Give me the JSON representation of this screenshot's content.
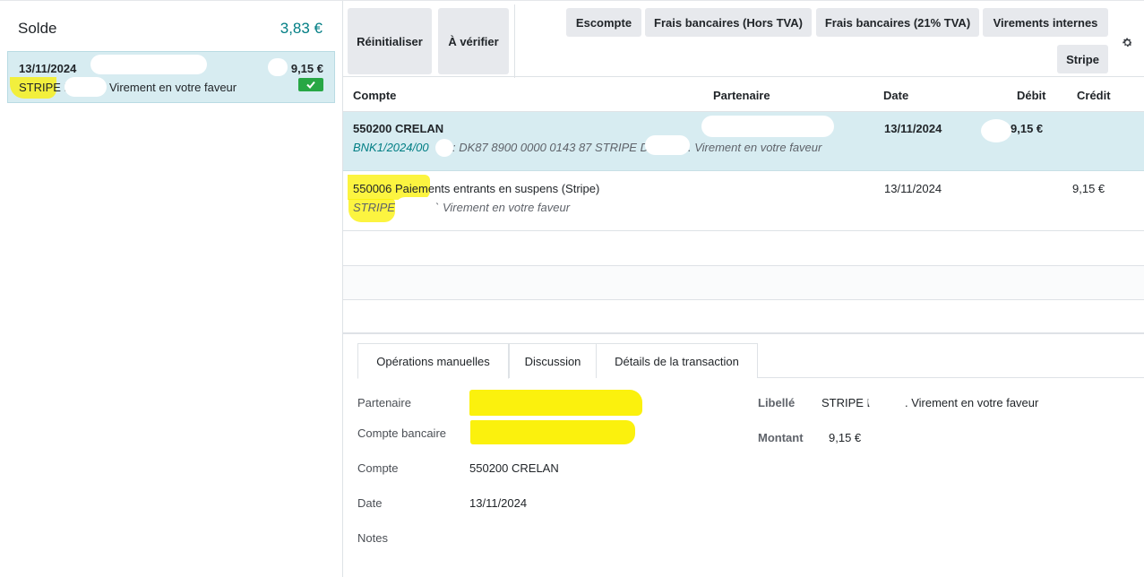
{
  "left": {
    "solde_label": "Solde",
    "solde_value": "3,83 €",
    "statement_line": {
      "date": "13/11/2024",
      "amount": "9,15 €",
      "label_prefix": "STRIPE D",
      "label_suffix": "Virement en votre faveur"
    }
  },
  "toolbar": {
    "reset": "Réinitialiser",
    "to_check": "À vérifier",
    "models": [
      "Escompte",
      "Frais bancaires (Hors TVA)",
      "Frais bancaires (21% TVA)",
      "Virements internes",
      "Stripe"
    ]
  },
  "grid": {
    "headers": {
      "account": "Compte",
      "partner": "Partenaire",
      "date": "Date",
      "debit": "Débit",
      "credit": "Crédit"
    },
    "rows": [
      {
        "account": "550200 CRELAN",
        "date": "13/11/2024",
        "debit": "9,15 €",
        "ref": "BNK1/2024/00",
        "memo": ": DK87 8900 0000 0143 87 STRIPE D",
        "memo_tail": ". Virement en votre faveur"
      },
      {
        "account": "550006 Paiements entrants en suspens (Stripe)",
        "date": "13/11/2024",
        "credit": "9,15 €",
        "memo": "STRIPE D",
        "memo_tail": "` Virement en votre faveur"
      }
    ]
  },
  "tabs": {
    "manual_ops": "Opérations manuelles",
    "discussion": "Discussion",
    "details": "Détails de la transaction"
  },
  "form": {
    "partner_label": "Partenaire",
    "bank_account_label": "Compte bancaire",
    "account_label": "Compte",
    "account_value": "550200 CRELAN",
    "date_label": "Date",
    "date_value": "13/11/2024",
    "notes_label": "Notes",
    "libelle_label": "Libellé",
    "libelle_prefix": "STRIPE D",
    "libelle_suffix": ". Virement en votre faveur",
    "montant_label": "Montant",
    "montant_value": "9,15 €"
  },
  "colors": {
    "accent": "#017e84",
    "selected_row": "#d7ecf1",
    "success": "#28a745",
    "highlight": "#fbf000"
  }
}
